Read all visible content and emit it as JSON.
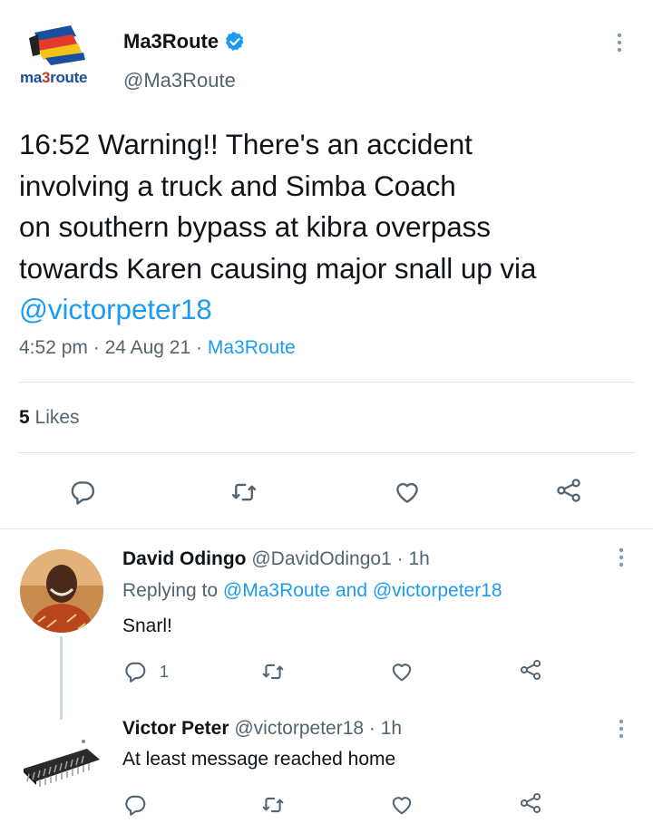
{
  "main_tweet": {
    "logo": {
      "part1": "ma",
      "part2": "3",
      "part3": "route"
    },
    "display_name": "Ma3Route",
    "handle": "@Ma3Route",
    "text_lines": [
      "16:52 Warning!! There's an accident",
      "involving a truck and Simba Coach",
      "on southern bypass at kibra overpass",
      "towards Karen causing major snall up via"
    ],
    "mention": "@victorpeter18",
    "time": "4:52 pm",
    "date": "24 Aug 21",
    "source": "Ma3Route",
    "likes_count": "5",
    "likes_label": "Likes"
  },
  "replies": [
    {
      "name": "David Odingo",
      "handle": "@DavidOdingo1",
      "age": "1h",
      "replying_prefix": "Replying to",
      "replying_to_1": "@Ma3Route",
      "replying_and": "and",
      "replying_to_2": "@victorpeter18",
      "text": "Snarl!",
      "reply_count": "1"
    },
    {
      "name": "Victor Peter",
      "handle": "@victorpeter18",
      "age": "1h",
      "text": "At least message reached home"
    }
  ],
  "colors": {
    "accent": "#1d9bf0",
    "muted": "#536471",
    "text": "#0f1419"
  },
  "icons": [
    "verified-badge-icon",
    "more-icon",
    "reply-icon",
    "retweet-icon",
    "like-icon",
    "share-icon"
  ]
}
